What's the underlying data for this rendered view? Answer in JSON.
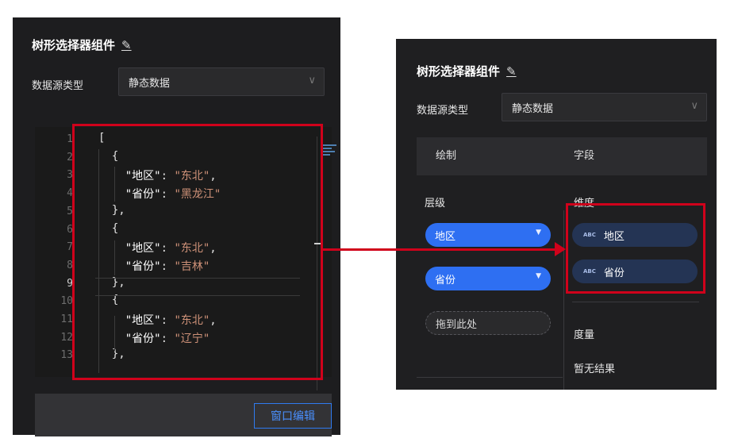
{
  "left_panel": {
    "title": "树形选择器组件",
    "datasource_label": "数据源类型",
    "datasource_value": "静态数据",
    "line_numbers": [
      "1",
      "2",
      "3",
      "4",
      "5",
      "6",
      "7",
      "8",
      "9",
      "10",
      "11",
      "12",
      "13"
    ],
    "code_lines": [
      {
        "tokens": [
          {
            "t": "p",
            "v": "["
          }
        ]
      },
      {
        "tokens": [
          {
            "t": "p",
            "v": "  {"
          }
        ]
      },
      {
        "tokens": [
          {
            "t": "p",
            "v": "    "
          },
          {
            "t": "k",
            "v": "\"地区\""
          },
          {
            "t": "p",
            "v": ": "
          },
          {
            "t": "s",
            "v": "\"东北\""
          },
          {
            "t": "p",
            "v": ","
          }
        ]
      },
      {
        "tokens": [
          {
            "t": "p",
            "v": "    "
          },
          {
            "t": "k",
            "v": "\"省份\""
          },
          {
            "t": "p",
            "v": ": "
          },
          {
            "t": "s",
            "v": "\"黑龙江\""
          }
        ]
      },
      {
        "tokens": [
          {
            "t": "p",
            "v": "  },"
          }
        ]
      },
      {
        "tokens": [
          {
            "t": "p",
            "v": "  {"
          }
        ]
      },
      {
        "tokens": [
          {
            "t": "p",
            "v": "    "
          },
          {
            "t": "k",
            "v": "\"地区\""
          },
          {
            "t": "p",
            "v": ": "
          },
          {
            "t": "s",
            "v": "\"东北\""
          },
          {
            "t": "p",
            "v": ","
          }
        ]
      },
      {
        "tokens": [
          {
            "t": "p",
            "v": "    "
          },
          {
            "t": "k",
            "v": "\"省份\""
          },
          {
            "t": "p",
            "v": ": "
          },
          {
            "t": "s",
            "v": "\"吉林\""
          }
        ]
      },
      {
        "tokens": [
          {
            "t": "p",
            "v": "  },"
          }
        ]
      },
      {
        "tokens": [
          {
            "t": "p",
            "v": "  {"
          }
        ]
      },
      {
        "tokens": [
          {
            "t": "p",
            "v": "    "
          },
          {
            "t": "k",
            "v": "\"地区\""
          },
          {
            "t": "p",
            "v": ": "
          },
          {
            "t": "s",
            "v": "\"东北\""
          },
          {
            "t": "p",
            "v": ","
          }
        ]
      },
      {
        "tokens": [
          {
            "t": "p",
            "v": "    "
          },
          {
            "t": "k",
            "v": "\"省份\""
          },
          {
            "t": "p",
            "v": ": "
          },
          {
            "t": "s",
            "v": "\"辽宁\""
          }
        ]
      },
      {
        "tokens": [
          {
            "t": "p",
            "v": "  },"
          }
        ]
      }
    ],
    "window_edit_label": "窗口编辑"
  },
  "right_panel": {
    "title": "树形选择器组件",
    "datasource_label": "数据源类型",
    "datasource_value": "静态数据",
    "tab_draw": "绘制",
    "tab_field": "字段",
    "level_label": "层级",
    "level_items": [
      "地区",
      "省份"
    ],
    "drop_placeholder": "拖到此处",
    "dimension_label": "维度",
    "dimension_items": [
      "地区",
      "省份"
    ],
    "field_type_badge": "ABC",
    "measure_label": "度量",
    "no_result": "暂无结果"
  },
  "colors": {
    "panel_bg": "#1d1d1f",
    "accent_blue": "#2e6ff2",
    "field_pill": "#243454",
    "annotation_red": "#d0021b",
    "string_color": "#ce9178"
  },
  "icons": {
    "edit": "pencil-icon",
    "dropdown": "chevron-down-icon",
    "pill_dropdown": "triangle-down-icon",
    "field_type": "abc-type-icon"
  }
}
